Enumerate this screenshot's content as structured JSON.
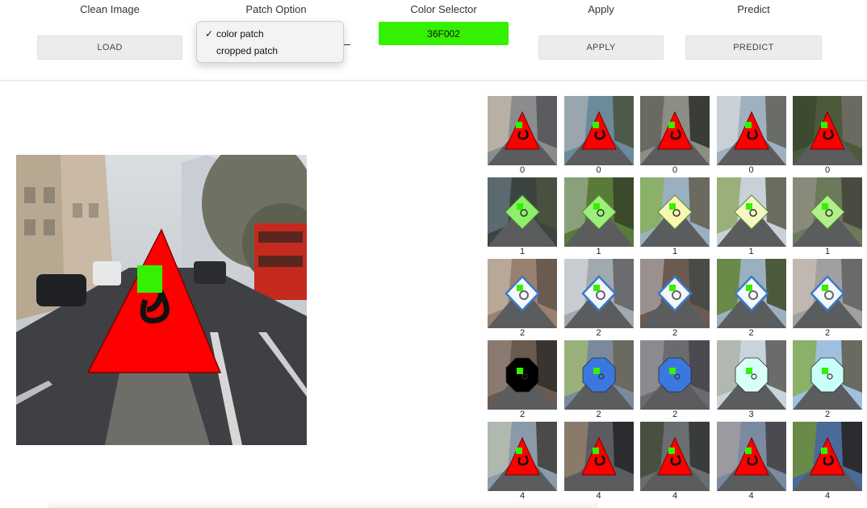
{
  "toolbar": {
    "clean_image": {
      "label": "Clean Image",
      "button": "LOAD"
    },
    "patch_option": {
      "label": "Patch Option",
      "options": [
        "color patch",
        "cropped patch"
      ],
      "selected": "color patch"
    },
    "color_selector": {
      "label": "Color Selector",
      "value": "36F002",
      "color": "#36F002"
    },
    "apply": {
      "label": "Apply",
      "button": "APPLY"
    },
    "predict": {
      "label": "Predict",
      "button": "PREDICT"
    }
  },
  "patch_color": "#36F002",
  "sign_colors": {
    "red": "#ff0000",
    "black": "#000000"
  },
  "grid": {
    "rows": [
      {
        "labels": [
          "0",
          "0",
          "0",
          "0",
          "0"
        ],
        "sign": "triangle"
      },
      {
        "labels": [
          "1",
          "1",
          "1",
          "1",
          "1"
        ],
        "sign": "diamond-green"
      },
      {
        "labels": [
          "2",
          "2",
          "2",
          "2",
          "2"
        ],
        "sign": "diamond-white"
      },
      {
        "labels": [
          "2",
          "2",
          "2",
          "3",
          "2"
        ],
        "sign": "octagon"
      },
      {
        "labels": [
          "4",
          "4",
          "4",
          "4",
          "4"
        ],
        "sign": "triangle"
      }
    ]
  }
}
